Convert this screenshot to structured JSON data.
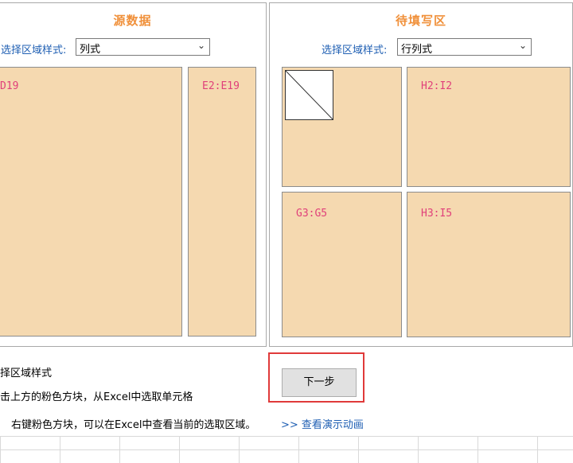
{
  "source_panel": {
    "title": "源数据",
    "style_label": "选择区域样式:",
    "style_value": "列式",
    "boxes": [
      {
        "range": "D19"
      },
      {
        "range": "E2:E19"
      }
    ]
  },
  "target_panel": {
    "title": "待填写区",
    "style_label": "选择区域样式:",
    "style_value": "行列式",
    "boxes": [
      {
        "range": ""
      },
      {
        "range": "H2:I2"
      },
      {
        "range": "G3:G5"
      },
      {
        "range": "H3:I5"
      }
    ]
  },
  "hints": {
    "line1": "择区域样式",
    "line2": "击上方的粉色方块，从Excel中选取单元格",
    "line3": "右键粉色方块，可以在Excel中查看当前的选取区域。",
    "demo_link": ">> 查看演示动画"
  },
  "actions": {
    "next_label": "下一步"
  },
  "colors": {
    "title": "#f0903a",
    "label": "#1f5fb3",
    "box_fill": "#f5d9b0",
    "range_text": "#e0407a",
    "highlight": "#e03a3a"
  }
}
